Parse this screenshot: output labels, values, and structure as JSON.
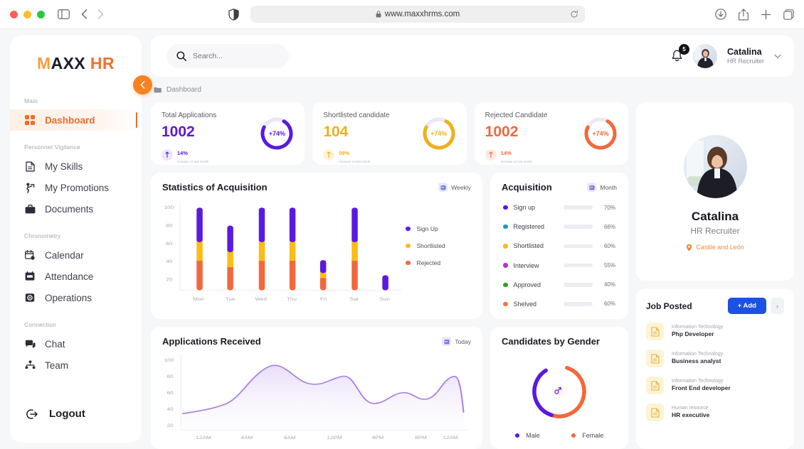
{
  "browser": {
    "url": "www.maxxhrms.com",
    "icons": [
      "shield-icon",
      "lock-icon",
      "reload-icon",
      "download-icon",
      "share-icon",
      "new-tab-icon",
      "tabs-icon"
    ]
  },
  "sidebar": {
    "logo": {
      "m": "M",
      "axx": "AXX",
      "hr": "HR"
    },
    "sections": [
      {
        "label": "Main",
        "items": [
          {
            "label": "Dashboard",
            "icon": "grid-icon",
            "active": true
          }
        ]
      },
      {
        "label": "Personnel Vigilance",
        "items": [
          {
            "label": "My Skills",
            "icon": "document-icon",
            "active": false
          },
          {
            "label": "My Promotions",
            "icon": "promotion-icon",
            "active": false
          },
          {
            "label": "Documents",
            "icon": "briefcase-icon",
            "active": false
          }
        ]
      },
      {
        "label": "Chronometry",
        "items": [
          {
            "label": "Calendar",
            "icon": "calendar-icon",
            "active": false
          },
          {
            "label": "Attendance",
            "icon": "attendance-icon",
            "active": false
          },
          {
            "label": "Operations",
            "icon": "operations-icon",
            "active": false
          }
        ]
      },
      {
        "label": "Connection",
        "items": [
          {
            "label": "Chat",
            "icon": "chat-icon",
            "active": false
          },
          {
            "label": "Team",
            "icon": "team-icon",
            "active": false
          }
        ]
      }
    ],
    "logout": "Logout",
    "collapse": "‹"
  },
  "topbar": {
    "search_placeholder": "Search...",
    "notification_count": "5",
    "user_name": "Catalina",
    "user_role": "HR Recruiter"
  },
  "breadcrumb": "Dashboard",
  "stats": [
    {
      "title": "Total Applications",
      "value": "1002",
      "ring_label": "+74%",
      "trend_pct": "14%",
      "trend_sub": "Increase vs last month",
      "color": "#5b19e0",
      "chip_bg": "#efe6fd"
    },
    {
      "title": "Shortlisted candidate",
      "value": "104",
      "ring_label": "+74%",
      "trend_pct": "09%",
      "trend_sub": "Increase vs last month",
      "color": "#f0b01b",
      "chip_bg": "#fdf3d8"
    },
    {
      "title": "Rejected Candidate",
      "value": "1002",
      "ring_label": "+74%",
      "trend_pct": "14%",
      "trend_sub": "Increase vs last month",
      "color": "#f2683c",
      "chip_bg": "#fdeae2"
    }
  ],
  "chart_data": [
    {
      "type": "bar",
      "title": "Statistics of Acquisition",
      "badge": "Weekly",
      "stacked": true,
      "categories": [
        "Mon",
        "Tue",
        "Wed",
        "Thu",
        "Fri",
        "Sat",
        "Sun"
      ],
      "series": [
        {
          "name": "Rejected",
          "color": "#f2683c",
          "values": [
            35,
            28,
            35,
            35,
            15,
            35,
            0
          ]
        },
        {
          "name": "Shortlisted",
          "color": "#fbbc16",
          "values": [
            21,
            17,
            21,
            21,
            7,
            21,
            0
          ]
        },
        {
          "name": "Sign Up",
          "color": "#5b19e0",
          "values": [
            44,
            35,
            44,
            44,
            13,
            44,
            17
          ]
        }
      ],
      "ylim": [
        0,
        110
      ],
      "yticks": [
        20,
        40,
        60,
        80,
        100
      ],
      "xlabel": "",
      "ylabel": "",
      "grid": false,
      "legend_position": "right"
    },
    {
      "type": "bar",
      "orientation": "horizontal",
      "title": "Acquisition",
      "badge": "Month",
      "categories": [
        "Sign up",
        "Registered",
        "Shortlisted",
        "Interview",
        "Approved",
        "Shelved"
      ],
      "values": [
        70,
        66,
        60,
        55,
        40,
        60
      ],
      "value_labels": [
        "70%",
        "66%",
        "60%",
        "55%",
        "40%",
        "60%"
      ],
      "colors": [
        "#6112e8",
        "#1d9bc2",
        "#fbbc16",
        "#b42fd8",
        "#2f9e1e",
        "#f2753c"
      ],
      "ylim": [
        0,
        100
      ]
    },
    {
      "type": "area",
      "title": "Applications Received",
      "badge": "Today",
      "x": [
        "12AM",
        "4AM",
        "8AM",
        "12PM",
        "4PM",
        "8PM",
        "12AM"
      ],
      "xticks": [
        "12AM",
        "4AM",
        "8AM",
        "12PM",
        "4PM",
        "8PM",
        "12AM"
      ],
      "values": [
        38,
        44,
        62,
        90,
        69,
        75,
        46,
        60,
        52,
        77,
        40
      ],
      "ylim": [
        15,
        105
      ],
      "yticks": [
        20,
        40,
        60,
        80,
        100
      ],
      "line_color": "#a07de0",
      "fill_color": "#f3edfc"
    },
    {
      "type": "pie",
      "title": "Candidates by Gender",
      "labels": [
        "Male",
        "Female"
      ],
      "values": [
        38,
        62
      ],
      "colors": [
        "#5b19e0",
        "#f2683c"
      ],
      "donut": true,
      "legend_position": "bottom"
    }
  ],
  "profile": {
    "name": "Catalina",
    "role": "HR Recruiter",
    "location": "Castile and León",
    "location_icon": "pin-icon"
  },
  "job_posted": {
    "title": "Job Posted",
    "add_label": "+ Add",
    "next_label": "›",
    "items": [
      {
        "dept": "Information Technology",
        "role": "Php Developer"
      },
      {
        "dept": "Information Technology",
        "role": "Business analyst"
      },
      {
        "dept": "Information Technology",
        "role": "Front End developer"
      },
      {
        "dept": "Human resource",
        "role": "HR executive"
      }
    ]
  }
}
